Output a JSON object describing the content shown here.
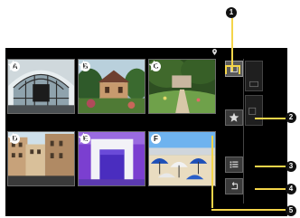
{
  "thumbnails": [
    {
      "letter": "A",
      "scene": "arched-glass-hall"
    },
    {
      "letter": "B",
      "scene": "garden-house"
    },
    {
      "letter": "C",
      "scene": "park-lawn"
    },
    {
      "letter": "D",
      "scene": "city-buildings"
    },
    {
      "letter": "E",
      "scene": "purple-arch"
    },
    {
      "letter": "F",
      "scene": "beach-umbrellas"
    }
  ],
  "callouts": [
    "1",
    "2",
    "3",
    "4",
    "5"
  ],
  "colors": {
    "callout_line": "#f4d54a",
    "screen_bg": "#000000"
  }
}
